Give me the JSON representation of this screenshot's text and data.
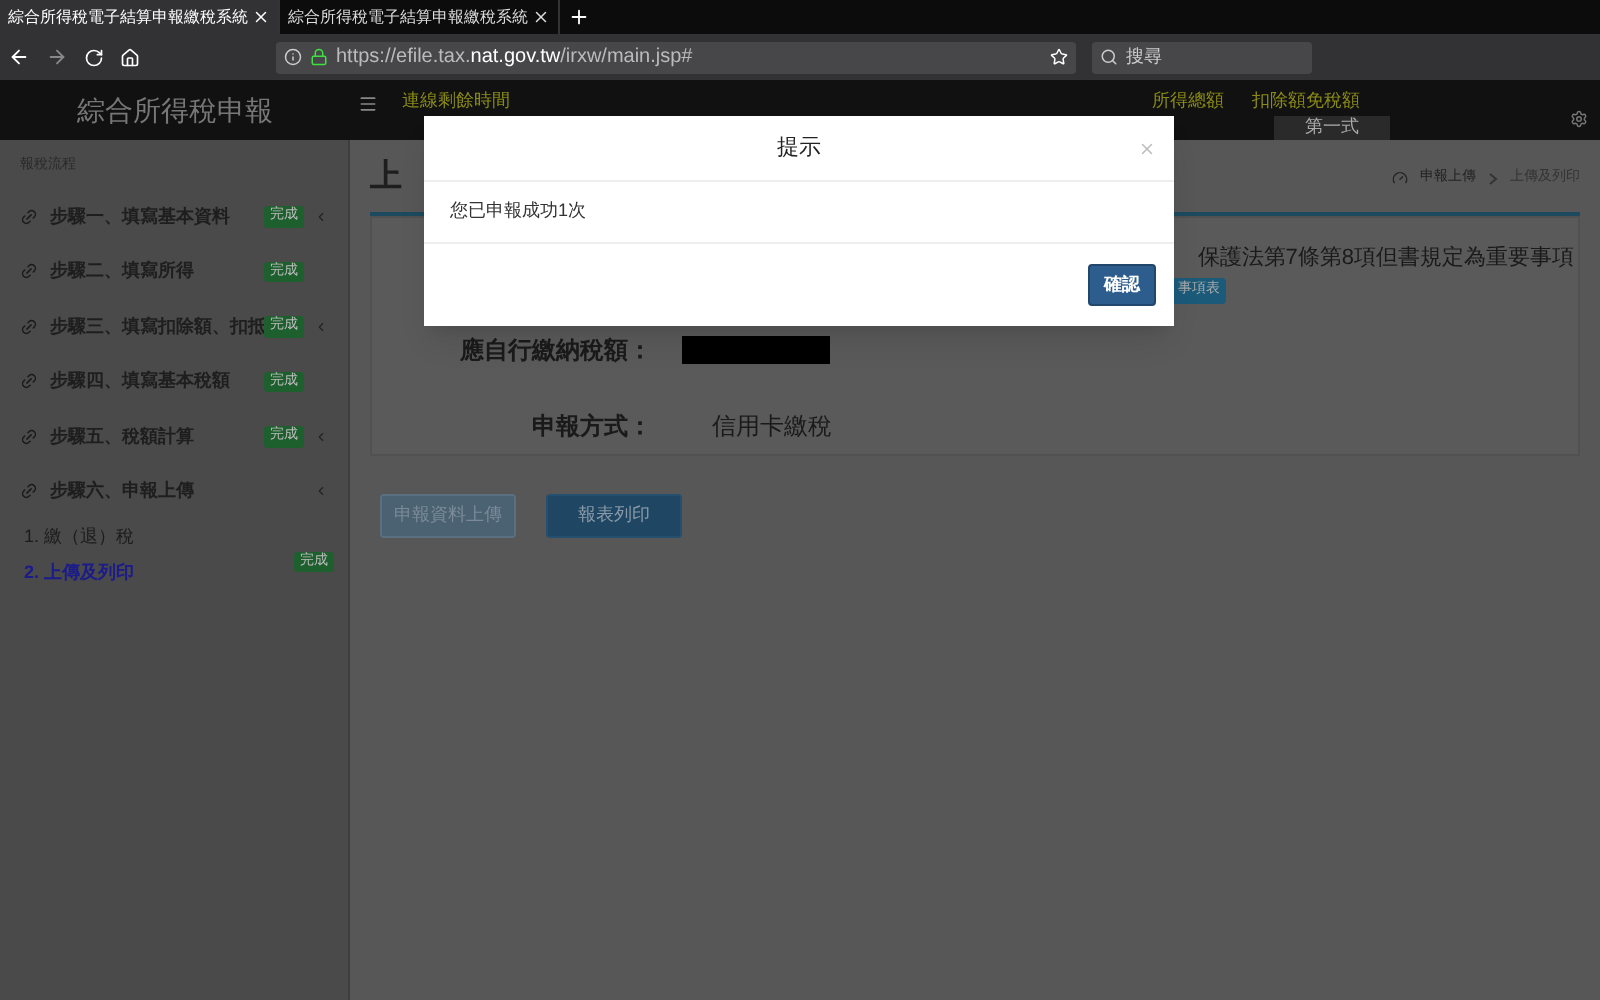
{
  "browser": {
    "tabs": [
      {
        "title": "綜合所得稅電子結算申報繳稅系統",
        "selected": true
      },
      {
        "title": "綜合所得稅電子結算申報繳稅系統",
        "selected": false
      }
    ],
    "url_prefix": "https://efile.tax.",
    "url_domain": "nat.gov.tw",
    "url_path": "/irxw/main.jsp#",
    "search": {
      "placeholder": "搜尋"
    }
  },
  "header": {
    "title": "綜合所得稅申報",
    "timer_label": "連線剩餘時間",
    "nav": [
      "所得總額",
      "扣除額免稅額"
    ],
    "form_tab": "第一式"
  },
  "sidebar": {
    "heading": "報稅流程",
    "items": [
      {
        "label": "步驟一、填寫基本資料",
        "badge": "完成",
        "submenu": true
      },
      {
        "label": "步驟二、填寫所得",
        "badge": "完成",
        "submenu": false
      },
      {
        "label": "步驟三、填寫扣除額、扣抵",
        "badge": "完成",
        "submenu": true
      },
      {
        "label": "步驟四、填寫基本稅額",
        "badge": "完成",
        "submenu": false
      },
      {
        "label": "步驟五、稅額計算",
        "badge": "完成",
        "submenu": true
      },
      {
        "label": "步驟六、申報上傳",
        "submenu": true,
        "children": [
          {
            "label": "1. 繳（退）稅",
            "selected": false
          },
          {
            "label": "2. 上傳及列印",
            "selected": true,
            "badge": "完成"
          }
        ]
      }
    ]
  },
  "content": {
    "title": "上",
    "breadcrumb": [
      "申報上傳",
      "上傳及列印"
    ],
    "notice": "保護法第7條第8項但書規定為重要事項",
    "notice_button": "事項表",
    "fields": [
      {
        "label": "應自行繳納稅額：",
        "redacted": true
      },
      {
        "label": "申報方式：",
        "value": "信用卡繳稅"
      }
    ],
    "buttons": [
      {
        "label": "申報資料上傳",
        "disabled": true
      },
      {
        "label": "報表列印",
        "disabled": false
      }
    ]
  },
  "dialog": {
    "title": "提示",
    "message": "您已申報成功1次",
    "confirm": "確認"
  }
}
